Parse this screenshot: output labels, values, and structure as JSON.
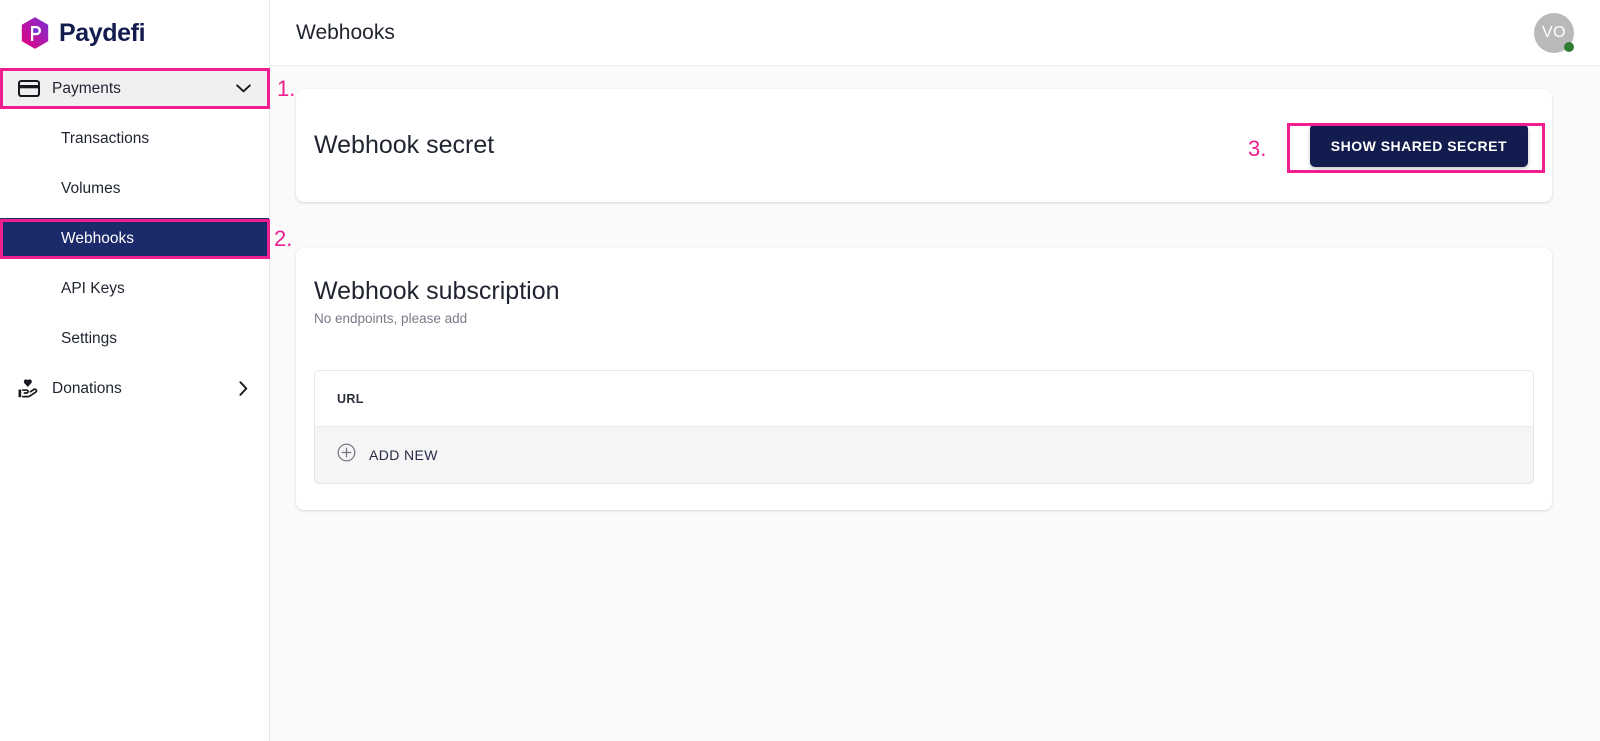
{
  "brand": {
    "name": "Paydefi",
    "logo_icon": "paydefi-hexagon-logo",
    "colors": {
      "gradient_start": "#e6007e",
      "gradient_end": "#7b2fd4",
      "wordmark": "#121c4e"
    }
  },
  "sidebar": {
    "groups": [
      {
        "label": "Payments",
        "icon": "credit-card-icon",
        "chevron": "chevron-down-icon",
        "expanded": true,
        "items": [
          {
            "label": "Transactions",
            "active": false
          },
          {
            "label": "Volumes",
            "active": false
          },
          {
            "label": "Webhooks",
            "active": true
          },
          {
            "label": "API Keys",
            "active": false
          },
          {
            "label": "Settings",
            "active": false
          }
        ]
      },
      {
        "label": "Donations",
        "icon": "hand-holding-heart-icon",
        "chevron": "chevron-right-icon",
        "expanded": false,
        "items": []
      }
    ]
  },
  "header": {
    "title": "Webhooks",
    "avatar": {
      "initials": "VO",
      "status": "online",
      "status_color": "#2e7d32"
    }
  },
  "secret_card": {
    "title": "Webhook secret",
    "button_label": "SHOW SHARED SECRET"
  },
  "subscription_card": {
    "title": "Webhook subscription",
    "caption": "No endpoints, please add",
    "table": {
      "columns": [
        "URL"
      ],
      "rows": [],
      "add_row": {
        "label": "ADD NEW",
        "icon": "plus-circle-icon"
      }
    }
  },
  "annotations": {
    "accent_color": "#f01f90",
    "markers": [
      {
        "number": "1.",
        "target": "payments-group-row"
      },
      {
        "number": "2.",
        "target": "sidebar-item-webhooks"
      },
      {
        "number": "3.",
        "target": "show-shared-secret-button"
      }
    ]
  }
}
